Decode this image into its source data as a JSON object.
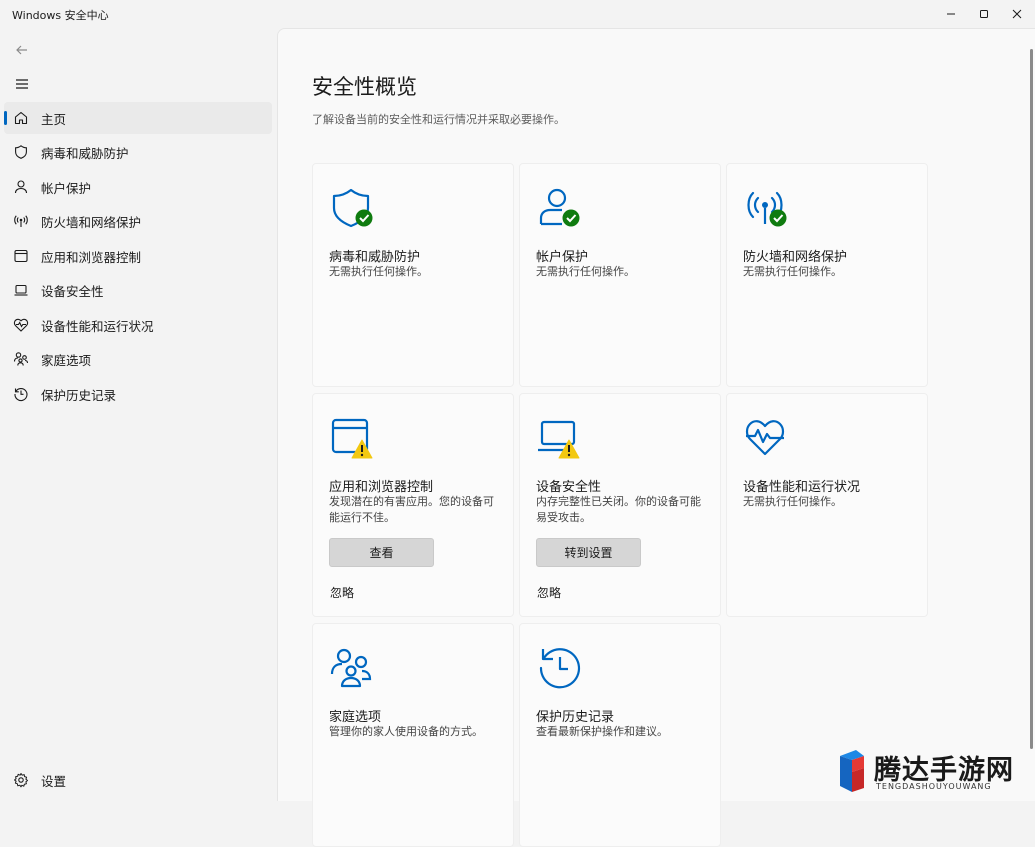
{
  "window": {
    "title": "Windows 安全中心"
  },
  "sidebar": {
    "items": [
      {
        "label": "主页",
        "icon": "home-icon"
      },
      {
        "label": "病毒和威胁防护",
        "icon": "shield-icon"
      },
      {
        "label": "帐户保护",
        "icon": "person-icon"
      },
      {
        "label": "防火墙和网络保护",
        "icon": "wireless-icon"
      },
      {
        "label": "应用和浏览器控制",
        "icon": "app-window-icon"
      },
      {
        "label": "设备安全性",
        "icon": "laptop-icon"
      },
      {
        "label": "设备性能和运行状况",
        "icon": "heart-pulse-icon"
      },
      {
        "label": "家庭选项",
        "icon": "family-icon"
      },
      {
        "label": "保护历史记录",
        "icon": "history-icon"
      }
    ],
    "settings_label": "设置"
  },
  "main": {
    "title": "安全性概览",
    "subtitle": "了解设备当前的安全性和运行情况并采取必要操作。",
    "cards": [
      {
        "title": "病毒和威胁防护",
        "desc": "无需执行任何操作。",
        "status": "ok"
      },
      {
        "title": "帐户保护",
        "desc": "无需执行任何操作。",
        "status": "ok"
      },
      {
        "title": "防火墙和网络保护",
        "desc": "无需执行任何操作。",
        "status": "ok"
      },
      {
        "title": "应用和浏览器控制",
        "desc": "发现潜在的有害应用。您的设备可能运行不佳。",
        "status": "warning",
        "button": "查看",
        "link": "忽略"
      },
      {
        "title": "设备安全性",
        "desc": "内存完整性已关闭。你的设备可能易受攻击。",
        "status": "warning",
        "button": "转到设置",
        "link": "忽略"
      },
      {
        "title": "设备性能和运行状况",
        "desc": "无需执行任何操作。",
        "status": "none"
      },
      {
        "title": "家庭选项",
        "desc": "管理你的家人使用设备的方式。",
        "status": "none"
      },
      {
        "title": "保护历史记录",
        "desc": "查看最新保护操作和建议。",
        "status": "none"
      }
    ]
  },
  "watermark": {
    "name": "腾达手游网",
    "sub": "TENGDASHOUYOUWANG"
  },
  "colors": {
    "accent": "#0067c0",
    "ok": "#0f7b0f",
    "warning": "#f2c811"
  }
}
